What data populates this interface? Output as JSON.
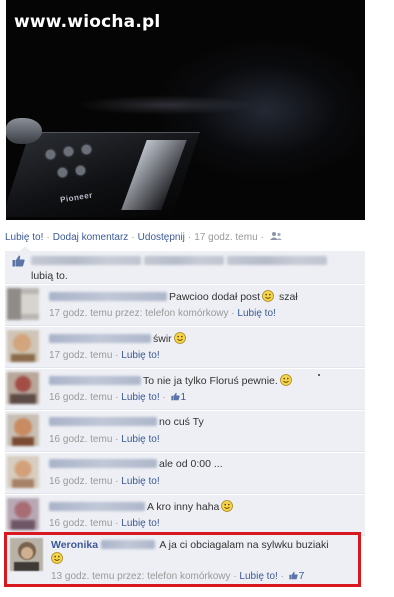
{
  "photo": {
    "watermark": "www.wiocha.pl",
    "brand": "Pioneer"
  },
  "post_actions": {
    "like": "Lubię to!",
    "comment": "Dodaj komentarz",
    "share": "Udostępnij",
    "time": "17 godz. temu"
  },
  "likes": {
    "suffix": "lubią to."
  },
  "comments": [
    {
      "text": "Pawcioo dodał post",
      "emoticon": "smiley-icon",
      "text_after": " szał",
      "time": "17 godz. temu przez: telefon komórkowy",
      "like": "Lubię to!",
      "like_count": ""
    },
    {
      "text": "świr",
      "emoticon": "smiley-icon",
      "text_after": "",
      "time": "17 godz. temu",
      "like": "Lubię to!",
      "like_count": ""
    },
    {
      "text": "To nie ja tylko Floruś pewnie.",
      "emoticon": "smiley-icon",
      "text_after": "",
      "time": "16 godz. temu",
      "like": "Lubię to!",
      "like_count": "1"
    },
    {
      "text": "no cuś Ty",
      "emoticon": "",
      "text_after": "",
      "time": "16 godz. temu",
      "like": "Lubię to!",
      "like_count": ""
    },
    {
      "text": "ale od 0:00 ...",
      "emoticon": "",
      "text_after": "",
      "time": "16 godz. temu",
      "like": "Lubię to!",
      "like_count": ""
    },
    {
      "text": "A kro inny haha",
      "emoticon": "smiley-icon",
      "text_after": "",
      "time": "16 godz. temu",
      "like": "Lubię to!",
      "like_count": ""
    }
  ],
  "highlighted_comment": {
    "author": "Weronika",
    "text": "A ja ci obciagalam na sylwku buziaki",
    "emoticon": "smiley-icon",
    "time": "13 godz. temu przez: telefon komórkowy",
    "like": "Lubię to!",
    "like_count": "7",
    "highlight_color": "#d8181e"
  },
  "colors": {
    "link": "#3b5998",
    "comment_bg": "#edeff4",
    "meta": "#999999"
  }
}
